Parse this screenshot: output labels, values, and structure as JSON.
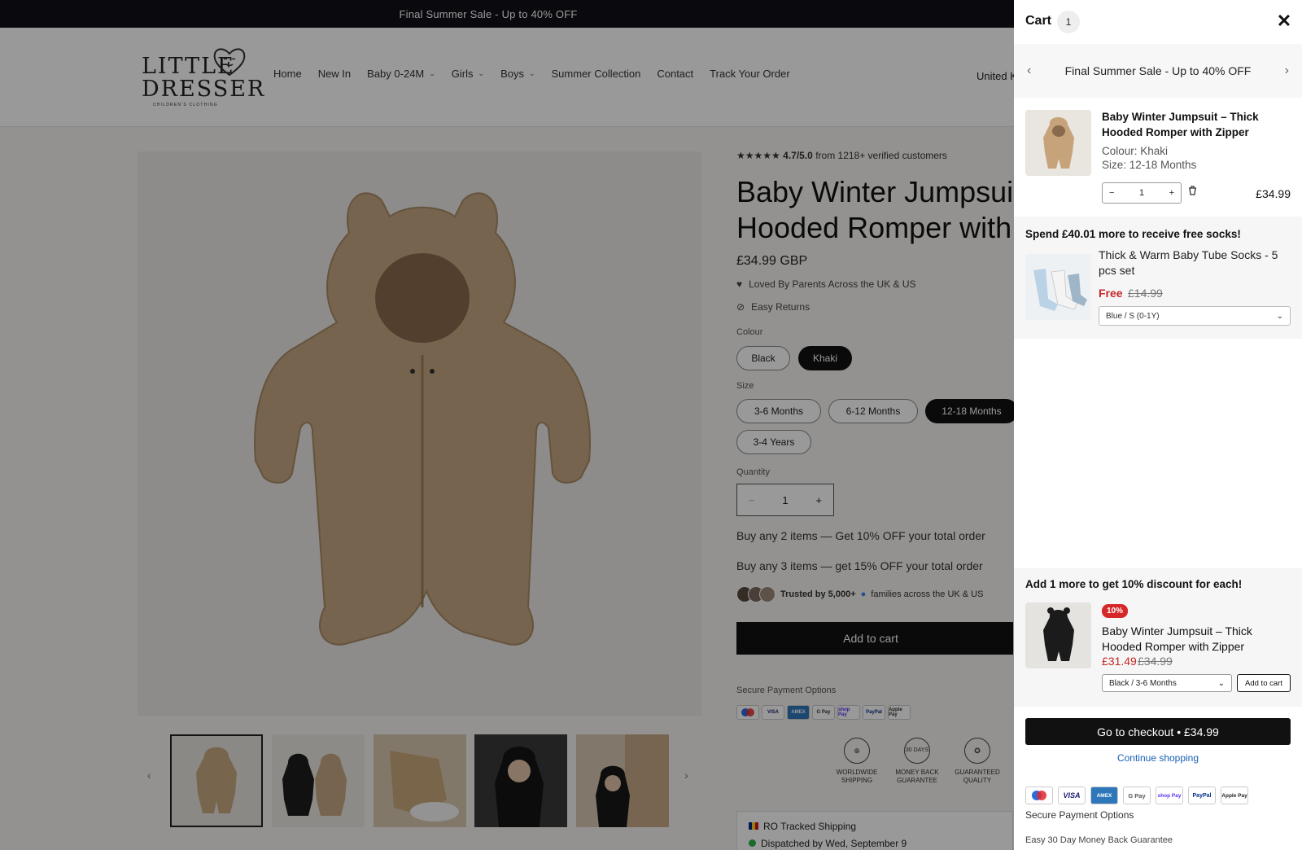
{
  "announcement": "Final Summer Sale - Up to 40% OFF",
  "logo": {
    "line1": "LITTLE",
    "line2": "DRESSER",
    "tagline": "CHILDREN'S CLOTHING"
  },
  "nav": [
    "Home",
    "New In",
    "Baby 0-24M",
    "Girls",
    "Boys",
    "Summer Collection",
    "Contact",
    "Track Your Order"
  ],
  "country": "United K",
  "product": {
    "rating_stars": "★★★★★",
    "rating": "4.7/5.0",
    "rating_text": "from 1218+ verified customers",
    "title_line1": "Baby Winter Jumpsuit –",
    "title_line2": "Hooded Romper with Z",
    "price": "£34.99 GBP",
    "perk1": "Loved By Parents Across the UK & US",
    "perk2": "Easy Returns",
    "colour_label": "Colour",
    "colours": [
      "Black",
      "Khaki"
    ],
    "size_label": "Size",
    "sizes": [
      "3-6 Months",
      "6-12 Months",
      "12-18 Months",
      "3-4 Years"
    ],
    "quantity_label": "Quantity",
    "quantity": "1",
    "offer1": "Buy any 2 items — Get 10% OFF your total order",
    "offer2": "Buy any 3 items — get 15% OFF your total order",
    "trust_bold": "Trusted by 5,000+",
    "trust_rest": "families across the UK & US",
    "add_to_cart": "Add to cart",
    "secure_payment": "Secure Payment Options",
    "badges": [
      {
        "l1": "WORLDWIDE",
        "l2": "SHIPPING"
      },
      {
        "l1": "MONEY BACK",
        "l2": "GUARANTEE",
        "icon_text": "30 DAYS"
      },
      {
        "l1": "GUARANTEED",
        "l2": "QUALITY"
      }
    ],
    "shipping_line1": "RO Tracked Shipping",
    "shipping_line2": "Dispatched by Wed, September 9"
  },
  "cart": {
    "title": "Cart",
    "count": "1",
    "announcement": "Final Summer Sale - Up to 40% OFF",
    "item": {
      "name": "Baby Winter Jumpsuit – Thick Hooded Romper with Zipper",
      "colour": "Colour: Khaki",
      "size": "Size: 12-18 Months",
      "quantity": "1",
      "price": "£34.99"
    },
    "gift": {
      "title": "Spend £40.01 more to receive free socks!",
      "name": "Thick & Warm Baby Tube Socks - 5 pcs set",
      "free": "Free",
      "old_price": "£14.99",
      "variant": "Blue / S (0-1Y)"
    },
    "upsell": {
      "title": "Add 1 more to get 10% discount for each!",
      "badge": "10%",
      "name": "Baby Winter Jumpsuit – Thick Hooded Romper with Zipper",
      "new_price": "£31.49",
      "old_price": "£34.99",
      "variant": "Black / 3-6 Months",
      "add_label": "Add to cart"
    },
    "checkout": "Go to checkout • £34.99",
    "continue": "Continue shopping",
    "secure_payment": "Secure Payment Options",
    "guarantee": "Easy 30 Day Money Back Guarantee"
  },
  "payment_methods": [
    "Maestro",
    "VISA",
    "AMEX",
    "G Pay",
    "shop Pay",
    "PayPal",
    "Apple Pay"
  ],
  "colors": {
    "sale_red": "#c62828",
    "badge_red": "#d62828",
    "link_blue": "#1a5fb4",
    "dark": "#111111"
  }
}
